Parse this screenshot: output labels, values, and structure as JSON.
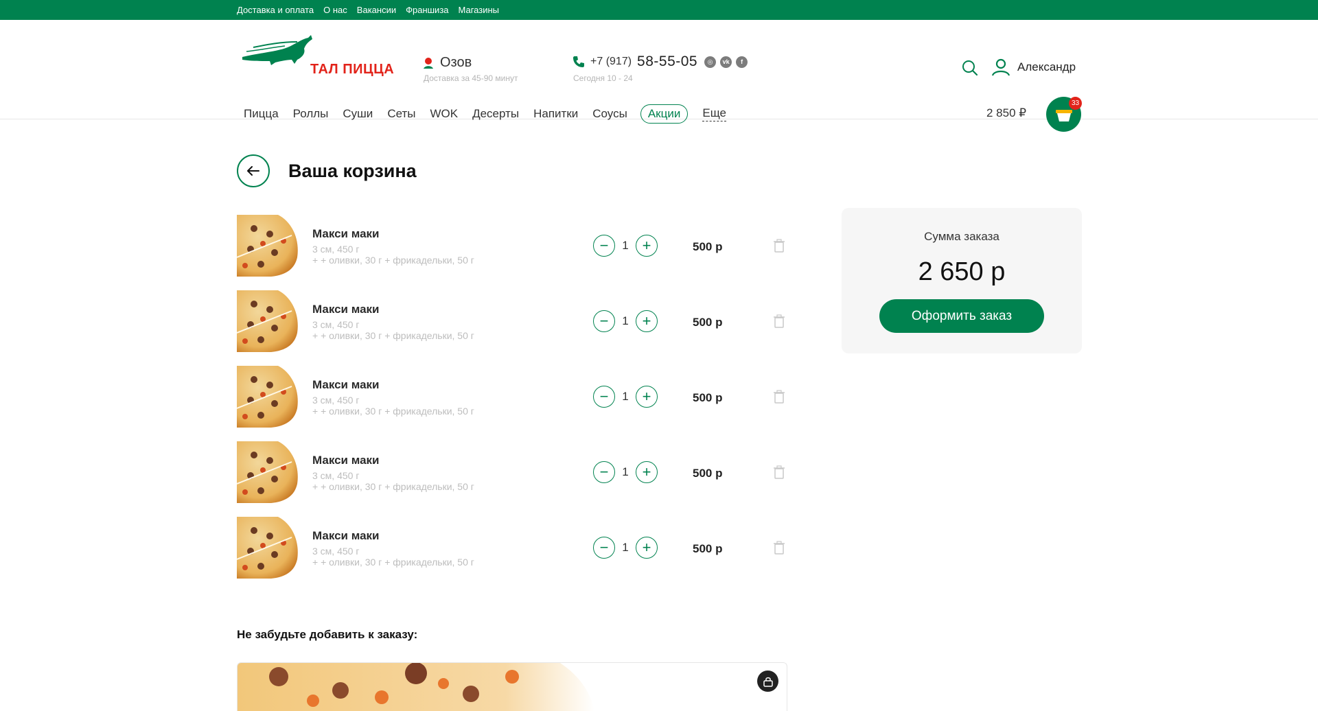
{
  "topbar": {
    "links": [
      "Доставка и оплата",
      "О нас",
      "Вакансии",
      "Франшиза",
      "Магазины"
    ]
  },
  "header": {
    "logo_text": "ТАЛ ПИЦЦА",
    "city": "Озов",
    "city_sub": "Доставка за 45-90 минут",
    "phone_prefix": "+7 (917)",
    "phone_number": "58-55-05",
    "phone_sub": "Сегодня 10 - 24",
    "user_name": "Александр",
    "cart_total": "2 850 ₽",
    "cart_count": "33"
  },
  "nav": {
    "items": [
      "Пицца",
      "Роллы",
      "Суши",
      "Сеты",
      "WOK",
      "Десерты",
      "Напитки",
      "Соусы"
    ],
    "promo": "Акции",
    "more": "Еще"
  },
  "page": {
    "title": "Ваша корзина"
  },
  "cart": {
    "items": [
      {
        "title": "Макси маки",
        "size": "3 см, 450 г",
        "extras": "+ + оливки, 30 г + фрикадельки, 50 г",
        "qty": "1",
        "price": "500 р"
      },
      {
        "title": "Макси маки",
        "size": "3 см, 450 г",
        "extras": "+ + оливки, 30 г + фрикадельки, 50 г",
        "qty": "1",
        "price": "500 р"
      },
      {
        "title": "Макси маки",
        "size": "3 см, 450 г",
        "extras": "+ + оливки, 30 г + фрикадельки, 50 г",
        "qty": "1",
        "price": "500 р"
      },
      {
        "title": "Макси маки",
        "size": "3 см, 450 г",
        "extras": "+ + оливки, 30 г + фрикадельки, 50 г",
        "qty": "1",
        "price": "500 р"
      },
      {
        "title": "Макси маки",
        "size": "3 см, 450 г",
        "extras": "+ + оливки, 30 г + фрикадельки, 50 г",
        "qty": "1",
        "price": "500 р"
      }
    ]
  },
  "summary": {
    "label": "Сумма заказа",
    "sum": "2 650 р",
    "order_button": "Оформить заказ"
  },
  "addon": {
    "title": "Не забудьте добавить к заказу:"
  },
  "colors": {
    "brand_green": "#00824f",
    "logo_red": "#e2231a"
  }
}
